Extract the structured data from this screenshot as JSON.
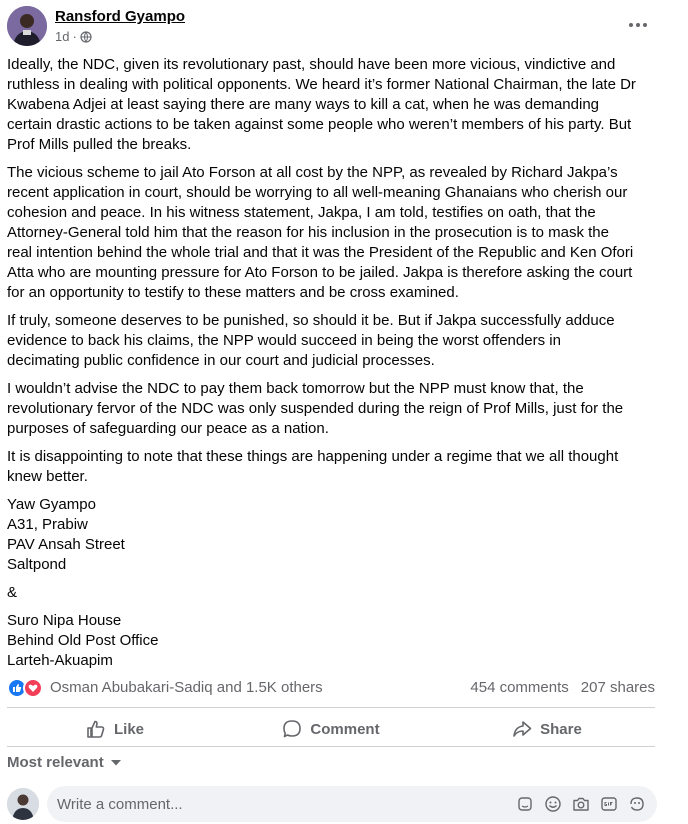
{
  "post": {
    "author": "Ransford Gyampo",
    "time": "1d",
    "dot": "·",
    "paragraphs": [
      "Ideally, the NDC, given its revolutionary past, should have been more vicious, vindictive and ruthless in dealing with political opponents. We heard it’s former National Chairman, the late Dr Kwabena Adjei at least saying there are many ways to kill a cat, when he was demanding certain drastic actions to be taken against some people who weren’t members of his party. But Prof Mills pulled the breaks.",
      "The vicious scheme to jail Ato Forson at all cost by the NPP, as revealed by Richard Jakpa’s recent application in court, should be worrying to all well-meaning Ghanaians who cherish our cohesion and peace. In his witness statement, Jakpa, I am told, testifies on oath, that the Attorney-General told him that the reason for his inclusion in the prosecution is to mask the real intention behind the whole trial and that it was the President of the Republic and Ken Ofori Atta who are mounting pressure for Ato Forson to be jailed. Jakpa is therefore asking the court for an opportunity to testify to these matters and be cross examined.",
      "If truly, someone deserves to be punished, so should it be. But if Jakpa successfully adduce evidence to back his claims, the NPP would succeed in being the worst offenders in decimating public confidence in our court and judicial processes.",
      "I wouldn’t advise the NDC to pay them back tomorrow but the NPP must know that, the revolutionary fervor of the NDC was only suspended during the reign of Prof Mills, just for the purposes of safeguarding our peace as a nation.",
      "It is disappointing to note that these things are happening under a regime that we all thought knew better."
    ],
    "signature": {
      "address1": [
        "Yaw Gyampo",
        "A31, Prabiw",
        "PAV Ansah Street",
        "Saltpond"
      ],
      "ampersand": "&",
      "address2": [
        "Suro Nipa House",
        "Behind Old Post Office",
        "Larteh-Akuapim"
      ]
    }
  },
  "reactions": {
    "names": "Osman Abubakari-Sadiq and 1.5K others",
    "comments": "454 comments",
    "shares": "207 shares",
    "icons": [
      "like-icon",
      "love-icon"
    ],
    "colors": {
      "like": "#1877f2",
      "love": "#f33e58"
    }
  },
  "actions": {
    "like": "Like",
    "comment": "Comment",
    "share": "Share"
  },
  "sort": {
    "label": "Most relevant"
  },
  "comment_box": {
    "placeholder": "Write a comment...",
    "tools": [
      "sticker-icon",
      "emoji-icon",
      "camera-icon",
      "gif-icon",
      "avatar-sticker-icon"
    ]
  }
}
